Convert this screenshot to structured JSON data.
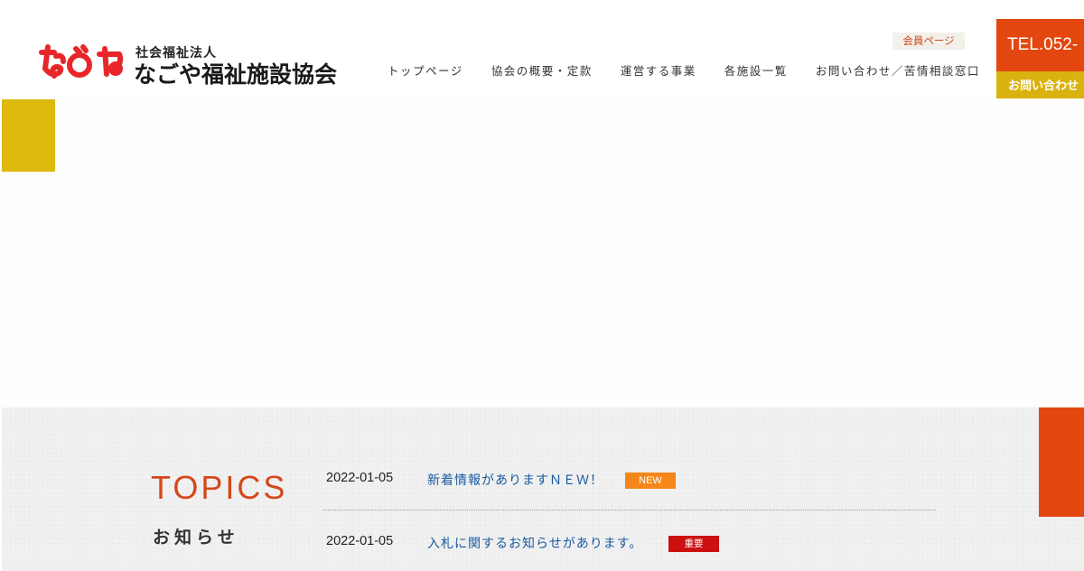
{
  "header": {
    "org_type": "社会福祉法人",
    "org_name": "なごや福祉施設協会",
    "logo_text": "なごや",
    "member_page": "会員ページ",
    "tel": "TEL.052-",
    "contact": "お問い合わせ"
  },
  "nav": {
    "items": [
      {
        "label": "トップページ"
      },
      {
        "label": "協会の概要・定款"
      },
      {
        "label": "運営する事業"
      },
      {
        "label": "各施設一覧"
      },
      {
        "label": "お問い合わせ／苦情相談窓口"
      }
    ]
  },
  "topics": {
    "title": "TOPICS",
    "subtitle": "お知らせ",
    "items": [
      {
        "date": "2022-01-05",
        "title": "新着情報がありますＮＥＷ！",
        "badge": "NEW",
        "badge_color": "#f5871a"
      },
      {
        "date": "2022-01-05",
        "title": "入札に関するお知らせがあります。",
        "badge": "重要",
        "badge_color": "#cc1010"
      }
    ]
  },
  "colors": {
    "accent_orange": "#e3470f",
    "accent_yellow": "#dcb90b",
    "logo_red": "#e8262a",
    "link_blue": "#1a5aa0"
  }
}
